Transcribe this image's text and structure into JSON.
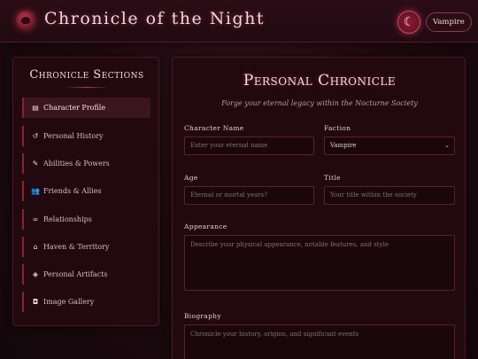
{
  "header": {
    "title": "Chronicle of the Night",
    "theme_icon": "crescent-moon-icon",
    "theme_glyph": "☾",
    "role": "Vampire"
  },
  "sidebar": {
    "title": "Chronicle Sections",
    "items": [
      {
        "label": "Character Profile",
        "icon": "id-card-icon",
        "glyph": "▤",
        "active": true
      },
      {
        "label": "Personal History",
        "icon": "history-icon",
        "glyph": "↺",
        "active": false
      },
      {
        "label": "Abilities & Powers",
        "icon": "wand-icon",
        "glyph": "✎",
        "active": false
      },
      {
        "label": "Friends & Allies",
        "icon": "users-icon",
        "glyph": "👥",
        "active": false
      },
      {
        "label": "Relationships",
        "icon": "mask-icon",
        "glyph": "∞",
        "active": false
      },
      {
        "label": "Haven & Territory",
        "icon": "landmark-icon",
        "glyph": "⌂",
        "active": false
      },
      {
        "label": "Personal Artifacts",
        "icon": "gem-icon",
        "glyph": "◈",
        "active": false
      },
      {
        "label": "Image Gallery",
        "icon": "camera-icon",
        "glyph": "◘",
        "active": false
      }
    ]
  },
  "main": {
    "title": "Personal Chronicle",
    "subtitle": "Forge your eternal legacy within the Nocturne Society",
    "fields": {
      "name": {
        "label": "Character Name",
        "placeholder": "Enter your eternal name"
      },
      "faction": {
        "label": "Faction",
        "value": "Vampire"
      },
      "age": {
        "label": "Age",
        "placeholder": "Eternal or mortal years?"
      },
      "title": {
        "label": "Title",
        "placeholder": "Your title within the society"
      },
      "appearance": {
        "label": "Appearance",
        "placeholder": "Describe your physical appearance, notable features, and style"
      },
      "biography": {
        "label": "Biography",
        "placeholder": "Chronicle your history, origins, and significant events"
      }
    }
  },
  "colors": {
    "background": "#1b0a10",
    "accent": "#c0394f",
    "panel": "#22090f",
    "border": "#4e1726"
  }
}
